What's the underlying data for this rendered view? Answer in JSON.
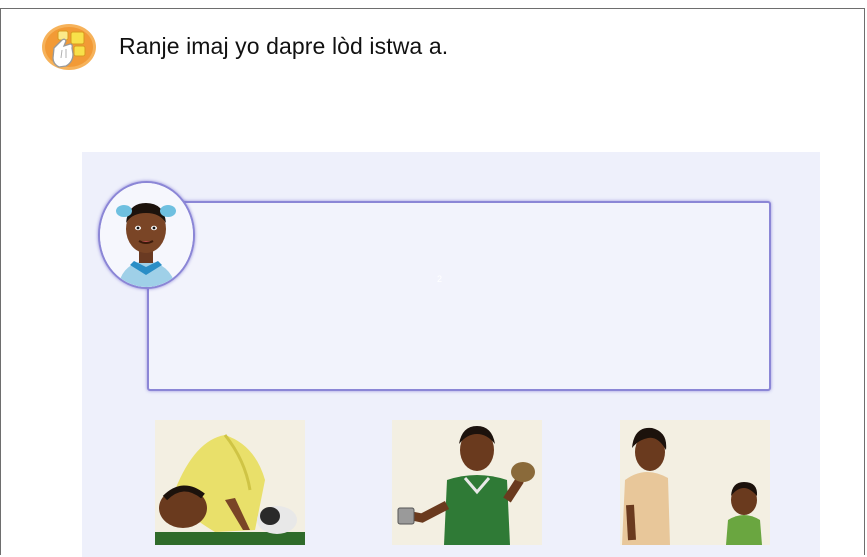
{
  "header": {
    "icon": "touch-sort-icon",
    "instruction": "Ranje imaj yo dapre lòd istwa a."
  },
  "activity": {
    "drop_zone_marker": "2",
    "narrator_avatar": "girl-avatar",
    "cards": [
      {
        "id": "card-1",
        "depicts": "girl-bending-over-ground"
      },
      {
        "id": "card-2",
        "depicts": "boy-holding-cup-and-stone"
      },
      {
        "id": "card-3",
        "depicts": "woman-and-boy"
      }
    ]
  },
  "colors": {
    "panel_background": "#eef0fb",
    "drop_zone_border": "#8b86d6",
    "icon_orange": "#f2a041"
  }
}
